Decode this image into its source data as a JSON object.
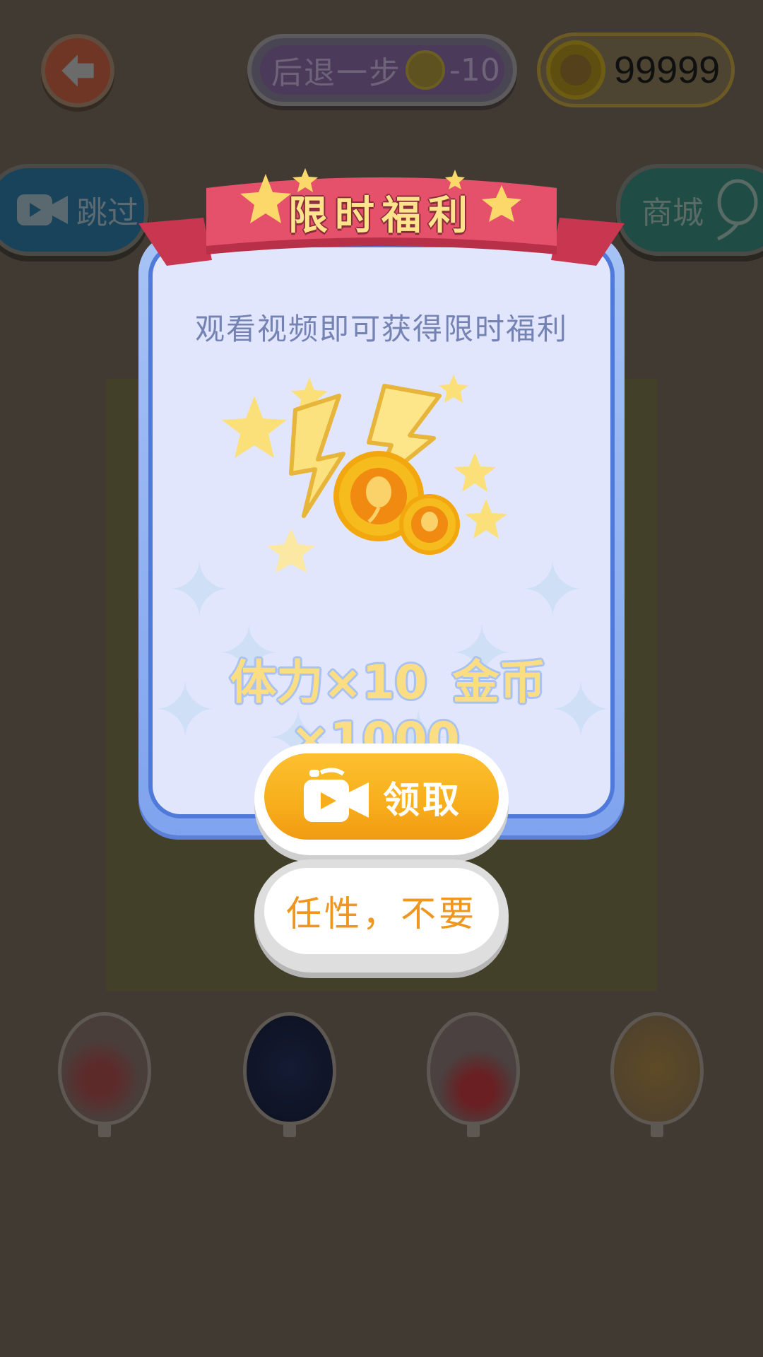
{
  "top_bar": {
    "undo_label": "后退一步",
    "undo_cost": "-10",
    "coin_count": "99999"
  },
  "side_buttons": {
    "skip_label": "跳过",
    "shop_label": "商城"
  },
  "popup": {
    "title": "限时福利",
    "subtitle": "观看视频即可获得限时福利",
    "reward_stamina": "体力×10",
    "reward_coins": "金币×1000",
    "claim_label": "领取",
    "decline_label": "任性，不要"
  },
  "icons": [
    "back-arrow-icon",
    "coin-icon",
    "video-camera-icon",
    "balloon-icon",
    "star-icon",
    "lightning-icon"
  ],
  "colors": {
    "overlay_bg": "#403a33",
    "ribbon": "#e5506a",
    "modal_border": "#4f7ad9",
    "modal_fill": "#e2e6fd",
    "claim_button": "#f7ae1c",
    "decline_text": "#ef9620",
    "reward_text": "#fbde84"
  }
}
